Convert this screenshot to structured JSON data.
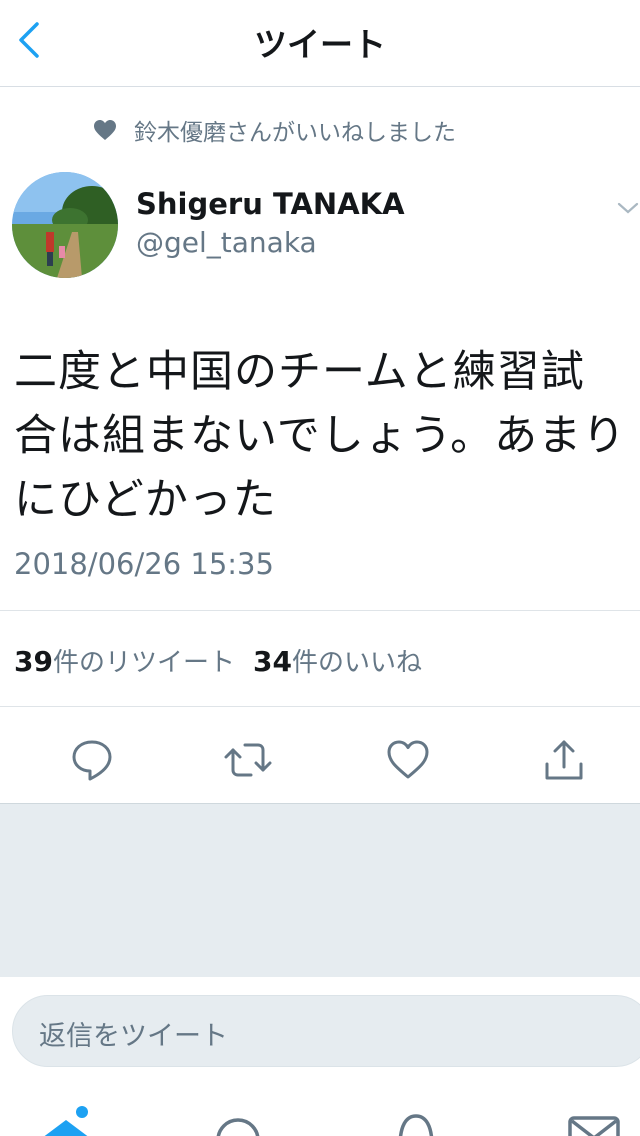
{
  "nav": {
    "title": "ツイート"
  },
  "context": {
    "liked_by": "鈴木優磨さんがいいねしました"
  },
  "tweet": {
    "author_name": "Shigeru TANAKA",
    "author_handle": "@gel_tanaka",
    "text": "二度と中国のチームと練習試合は組まないでしょう。あまりにひどかった",
    "timestamp": "2018/06/26 15:35"
  },
  "stats": {
    "retweets_count": "39",
    "retweets_label": "件のリツイート",
    "likes_count": "34",
    "likes_label": "件のいいね"
  },
  "reply": {
    "placeholder": "返信をツイート"
  },
  "icons": {
    "back": "chevron-left-icon",
    "liked": "heart-icon",
    "more": "chevron-down-icon",
    "reply": "reply-bubble-icon",
    "retweet": "retweet-icon",
    "like": "heart-outline-icon",
    "share": "share-icon",
    "tab_home": "home-icon",
    "tab_search": "search-icon",
    "tab_notifications": "bell-icon",
    "tab_messages": "mail-icon"
  },
  "colors": {
    "accent": "#1da1f2",
    "secondary_text": "#657786",
    "background_gray": "#e6ecf0"
  }
}
